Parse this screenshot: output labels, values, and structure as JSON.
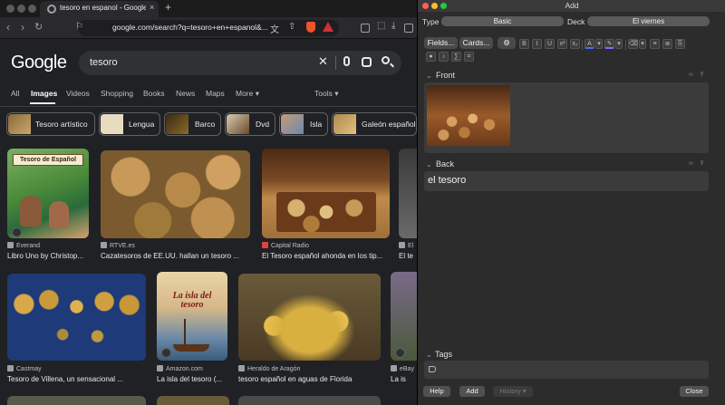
{
  "browser": {
    "tab_title": "tesoro en espanol - Google Search",
    "tab_close": "×",
    "new_tab": "+",
    "url": "google.com/search?q=tesoro+en+espanol&...",
    "search_query": "tesoro",
    "logo_text": "Google",
    "search_tabs": [
      "All",
      "Images",
      "Videos",
      "Shopping",
      "Books",
      "News",
      "Maps",
      "More",
      "Tools"
    ],
    "active_tab": "Images",
    "chips": [
      "Tesoro artístico",
      "Lengua",
      "Barco",
      "Dvd",
      "Isla",
      "Galeón español"
    ],
    "results": [
      {
        "source": "Everand",
        "caption": "Libro Uno by Christop...",
        "book_title": "Tesoro de Español"
      },
      {
        "source": "RTVE.es",
        "caption": "Cazatesoros de EE.UU. hallan un tesoro ..."
      },
      {
        "source": "Capital Radio",
        "caption": "El Tesoro español ahonda en los tip..."
      },
      {
        "source": "El",
        "caption": "El te"
      },
      {
        "source": "Castmay",
        "caption": "Tesoro de Villena, un sensacional ..."
      },
      {
        "source": "Amazon.com",
        "caption": "La isla del tesoro (...",
        "book_title": "La isla del tesoro"
      },
      {
        "source": "Heraldo de Aragón",
        "caption": "tesoro español en aguas de Florida"
      },
      {
        "source": "eBay",
        "caption": "La is"
      }
    ]
  },
  "anki": {
    "window_title": "Add",
    "type_label": "Type",
    "type_value": "Basic",
    "deck_label": "Deck",
    "deck_value": "El viernes",
    "fields_button": "Fields...",
    "cards_button": "Cards...",
    "front_label": "Front",
    "back_label": "Back",
    "back_value": "el tesoro",
    "tags_label": "Tags",
    "help_button": "Help",
    "add_button": "Add",
    "history_button": "History ▾",
    "close_button": "Close"
  },
  "colors": {
    "browser_bg": "#202124",
    "anki_bg": "#2c2c2c",
    "field_bg": "#3b3b3b",
    "accent_red": "#f0532a"
  }
}
